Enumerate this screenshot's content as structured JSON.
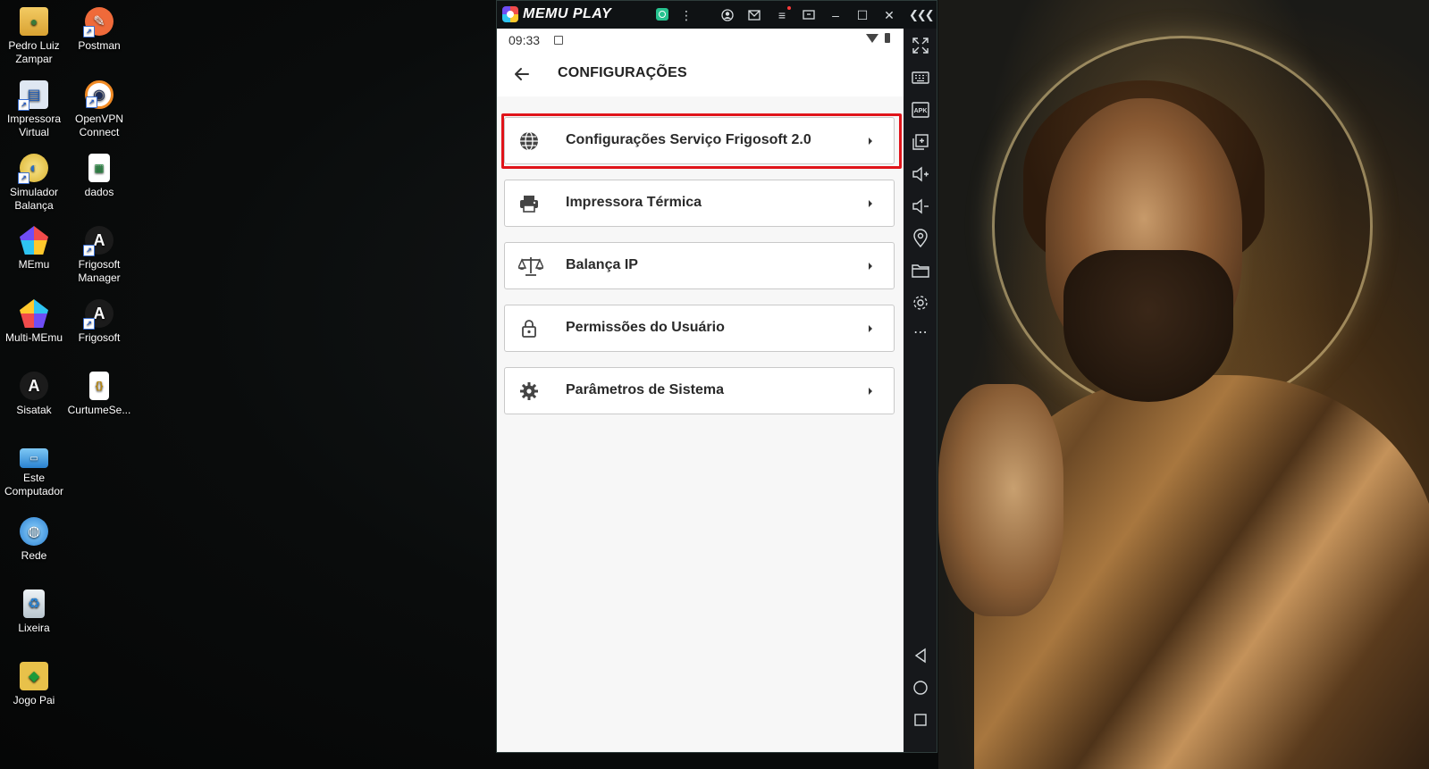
{
  "desktop": {
    "icons": [
      {
        "name": "Pedro Luiz Zampar",
        "line1": "Pedro Luiz",
        "line2": "Zampar"
      },
      {
        "name": "Postman",
        "line1": "Postman",
        "line2": ""
      },
      {
        "name": "Impressora Virtual",
        "line1": "Impressora",
        "line2": "Virtual"
      },
      {
        "name": "OpenVPN Connect",
        "line1": "OpenVPN",
        "line2": "Connect"
      },
      {
        "name": "Simulador Balança",
        "line1": "Simulador",
        "line2": "Balança"
      },
      {
        "name": "dados",
        "line1": "dados",
        "line2": ""
      },
      {
        "name": "MEmu",
        "line1": "MEmu",
        "line2": ""
      },
      {
        "name": "Frigosoft Manager",
        "line1": "Frigosoft",
        "line2": "Manager"
      },
      {
        "name": "Multi-MEmu",
        "line1": "Multi-MEmu",
        "line2": ""
      },
      {
        "name": "Frigosoft",
        "line1": "Frigosoft",
        "line2": ""
      },
      {
        "name": "Sisatak",
        "line1": "Sisatak",
        "line2": ""
      },
      {
        "name": "CurtumeSe...",
        "line1": "CurtumeSe...",
        "line2": ""
      },
      {
        "name": "Este Computador",
        "line1": "Este",
        "line2": "Computador"
      },
      {
        "name": "Rede",
        "line1": "Rede",
        "line2": ""
      },
      {
        "name": "Lixeira",
        "line1": "Lixeira",
        "line2": ""
      },
      {
        "name": "Jogo Pai",
        "line1": "Jogo Pai",
        "line2": ""
      }
    ]
  },
  "memu": {
    "title": "MEMU PLAY",
    "toolbar_icons": [
      "memu-assistant-icon",
      "more-vertical-icon",
      "account-icon",
      "mail-icon",
      "menu-icon",
      "screen-icon",
      "minimize-icon",
      "maximize-icon",
      "close-icon",
      "collapse-icon"
    ],
    "side_icons": [
      "fullscreen-icon",
      "keyboard-icon",
      "apk-icon",
      "multi-window-icon",
      "volume-up-icon",
      "volume-down-icon",
      "location-icon",
      "folder-icon",
      "settings-icon",
      "more-horizontal-icon",
      "nav-back-icon",
      "nav-home-icon",
      "nav-recents-icon"
    ]
  },
  "android": {
    "status": {
      "time": "09:33"
    },
    "app_bar": {
      "title": "CONFIGURAÇÕES"
    },
    "menu": [
      {
        "label": "Configurações Serviço Frigosoft 2.0",
        "icon": "globe-icon",
        "highlighted": true
      },
      {
        "label": "Impressora Térmica",
        "icon": "printer-icon",
        "highlighted": false
      },
      {
        "label": "Balança IP",
        "icon": "scale-icon",
        "highlighted": false
      },
      {
        "label": "Permissões do Usuário",
        "icon": "lock-icon",
        "highlighted": false
      },
      {
        "label": "Parâmetros de Sistema",
        "icon": "gear-icon",
        "highlighted": false
      }
    ]
  },
  "colors": {
    "highlight": "#e0141a",
    "screen_bg": "#f7f7f7",
    "toolbar_bg": "#16181b"
  }
}
